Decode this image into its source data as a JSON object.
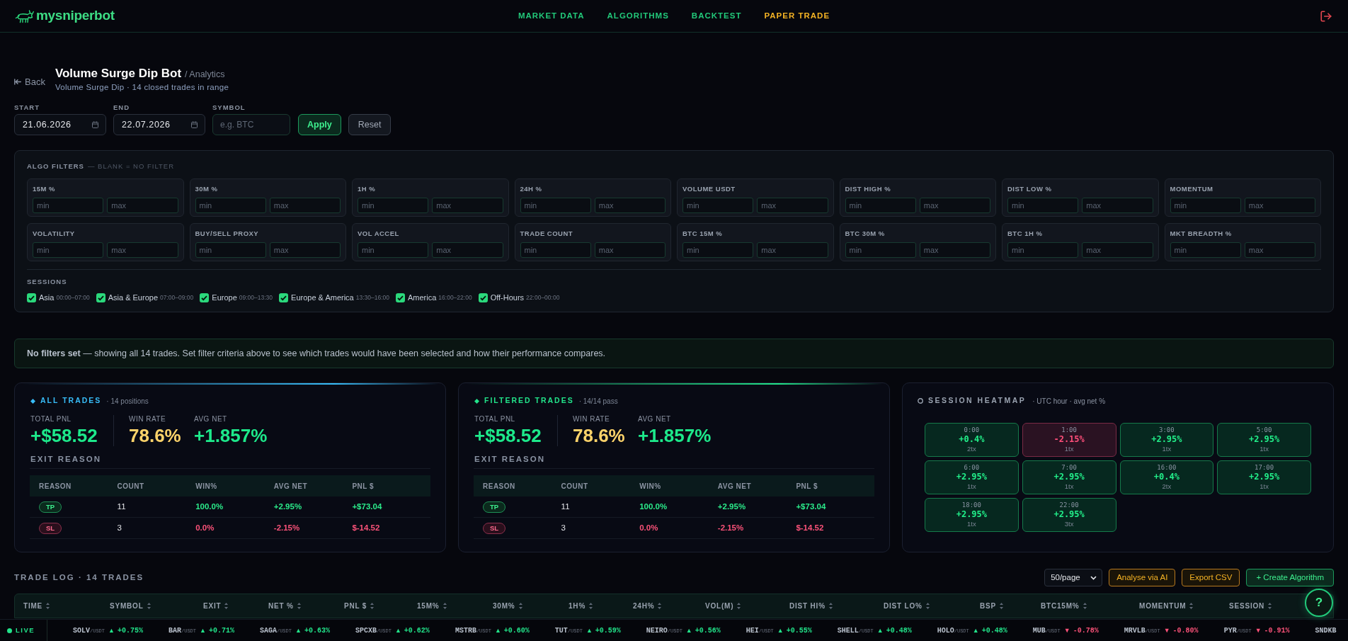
{
  "header": {
    "logo": "mysniperbot",
    "nav": [
      {
        "label": "MARKET DATA",
        "selected": false
      },
      {
        "label": "ALGORITHMS",
        "selected": false
      },
      {
        "label": "BACKTEST",
        "selected": false
      },
      {
        "label": "PAPER TRADE",
        "selected": true
      }
    ]
  },
  "page": {
    "back": "Back",
    "title": "Volume Surge Dip Bot",
    "breadcrumb": "/ Analytics",
    "subtitle": "Volume Surge Dip · 14 closed trades in range"
  },
  "range_filters": {
    "fields": [
      {
        "label": "START",
        "kind": "date",
        "value": "21.06.2026"
      },
      {
        "label": "END",
        "kind": "date",
        "value": "22.07.2026"
      },
      {
        "label": "SYMBOL",
        "kind": "text",
        "placeholder": "e.g. BTC"
      }
    ],
    "buttons": [
      {
        "label": "Apply",
        "kind": "primary"
      },
      {
        "label": "Reset",
        "kind": "secondary"
      }
    ]
  },
  "algo_filters": {
    "title": "ALGO FILTERS",
    "note": "— BLANK = NO FILTER",
    "groups": [
      {
        "label": "15M %",
        "inputs": [
          {
            "placeholder": "min"
          },
          {
            "placeholder": "max"
          }
        ]
      },
      {
        "label": "30M %",
        "inputs": [
          {
            "placeholder": "min"
          },
          {
            "placeholder": "max"
          }
        ]
      },
      {
        "label": "1H %",
        "inputs": [
          {
            "placeholder": "min"
          },
          {
            "placeholder": "max"
          }
        ]
      },
      {
        "label": "24H %",
        "inputs": [
          {
            "placeholder": "min"
          },
          {
            "placeholder": "max"
          }
        ]
      },
      {
        "label": "VOLUME USDT",
        "inputs": [
          {
            "placeholder": "min"
          },
          {
            "placeholder": "max"
          }
        ]
      },
      {
        "label": "DIST HIGH %",
        "inputs": [
          {
            "placeholder": "min"
          },
          {
            "placeholder": "max"
          }
        ]
      },
      {
        "label": "DIST LOW %",
        "inputs": [
          {
            "placeholder": "min"
          },
          {
            "placeholder": "max"
          }
        ]
      },
      {
        "label": "MOMENTUM",
        "inputs": [
          {
            "placeholder": "min"
          },
          {
            "placeholder": "max"
          }
        ]
      },
      {
        "label": "VOLATILITY",
        "inputs": [
          {
            "placeholder": "min"
          },
          {
            "placeholder": "max"
          }
        ]
      },
      {
        "label": "BUY/SELL PROXY",
        "inputs": [
          {
            "placeholder": "min"
          },
          {
            "placeholder": "max"
          }
        ]
      },
      {
        "label": "VOL ACCEL",
        "inputs": [
          {
            "placeholder": "min"
          },
          {
            "placeholder": "max"
          }
        ]
      },
      {
        "label": "TRADE COUNT",
        "inputs": [
          {
            "placeholder": "min"
          },
          {
            "placeholder": "max"
          }
        ]
      },
      {
        "label": "BTC 15M %",
        "inputs": [
          {
            "placeholder": "min"
          },
          {
            "placeholder": "max"
          }
        ]
      },
      {
        "label": "BTC 30M %",
        "inputs": [
          {
            "placeholder": "min"
          },
          {
            "placeholder": "max"
          }
        ]
      },
      {
        "label": "BTC 1H %",
        "inputs": [
          {
            "placeholder": "min"
          },
          {
            "placeholder": "max"
          }
        ]
      },
      {
        "label": "MKT BREADTH %",
        "inputs": [
          {
            "placeholder": "min"
          },
          {
            "placeholder": "max"
          }
        ]
      }
    ],
    "sessions": {
      "label": "SESSIONS",
      "items": [
        {
          "name": "Asia",
          "hours": "00:00–07:00",
          "checked": true
        },
        {
          "name": "Asia & Europe",
          "hours": "07:00–09:00",
          "checked": true
        },
        {
          "name": "Europe",
          "hours": "09:00–13:30",
          "checked": true
        },
        {
          "name": "Europe & America",
          "hours": "13:30–16:00",
          "checked": true
        },
        {
          "name": "America",
          "hours": "16:00–22:00",
          "checked": true
        },
        {
          "name": "Off-Hours",
          "hours": "22:00–00:00",
          "checked": true
        }
      ]
    }
  },
  "notice": "**No filters set** — showing all 14 trades. Set filter criteria above to see which trades would have been selected and how their performance compares.",
  "summary_cards": [
    {
      "title": "ALL TRADES",
      "meta": "· 14 positions",
      "color": "#38bdf8",
      "stats": [
        {
          "label": "TOTAL PNL",
          "value": "+$58.52",
          "kind": "pnl"
        },
        {
          "label": "WIN RATE",
          "value": "78.6%",
          "kind": "rate"
        },
        {
          "label": "AVG NET",
          "value": "+1.857%",
          "kind": "net"
        }
      ],
      "exit_reason": {
        "title": "EXIT REASON",
        "columns": [
          "REASON",
          "COUNT",
          "WIN%",
          "AVG NET",
          "PNL $"
        ],
        "rows": [
          {
            "reason": "TP",
            "negative": false,
            "count": "11",
            "win": "100.0%",
            "avg_net": "+2.95%",
            "pnl": "+$73.04"
          },
          {
            "reason": "SL",
            "negative": true,
            "count": "3",
            "win": "0.0%",
            "avg_net": "-2.15%",
            "pnl": "$-14.52"
          }
        ]
      }
    },
    {
      "title": "FILTERED TRADES",
      "meta": "· 14/14 pass",
      "color": "#22e38a",
      "stats": [
        {
          "label": "TOTAL PNL",
          "value": "+$58.52",
          "kind": "pnl"
        },
        {
          "label": "WIN RATE",
          "value": "78.6%",
          "kind": "rate"
        },
        {
          "label": "AVG NET",
          "value": "+1.857%",
          "kind": "net"
        }
      ],
      "exit_reason": {
        "title": "EXIT REASON",
        "columns": [
          "REASON",
          "COUNT",
          "WIN%",
          "AVG NET",
          "PNL $"
        ],
        "rows": [
          {
            "reason": "TP",
            "negative": false,
            "count": "11",
            "win": "100.0%",
            "avg_net": "+2.95%",
            "pnl": "+$73.04"
          },
          {
            "reason": "SL",
            "negative": true,
            "count": "3",
            "win": "0.0%",
            "avg_net": "-2.15%",
            "pnl": "$-14.52"
          }
        ]
      }
    }
  ],
  "heatmap": {
    "title": "SESSION HEATMAP",
    "meta": "· UTC hour · avg net %",
    "cells": [
      {
        "hour": "0:00",
        "value": "+0.4%",
        "count": "2tx",
        "negative": false
      },
      {
        "hour": "1:00",
        "value": "-2.15%",
        "count": "1tx",
        "negative": true
      },
      {
        "hour": "3:00",
        "value": "+2.95%",
        "count": "1tx",
        "negative": false
      },
      {
        "hour": "5:00",
        "value": "+2.95%",
        "count": "1tx",
        "negative": false
      },
      {
        "hour": "6:00",
        "value": "+2.95%",
        "count": "1tx",
        "negative": false
      },
      {
        "hour": "7:00",
        "value": "+2.95%",
        "count": "1tx",
        "negative": false
      },
      {
        "hour": "16:00",
        "value": "+0.4%",
        "count": "2tx",
        "negative": false
      },
      {
        "hour": "17:00",
        "value": "+2.95%",
        "count": "1tx",
        "negative": false
      },
      {
        "hour": "18:00",
        "value": "+2.95%",
        "count": "1tx",
        "negative": false
      },
      {
        "hour": "22:00",
        "value": "+2.95%",
        "count": "3tx",
        "negative": false
      }
    ]
  },
  "trade_log": {
    "title": "TRADE LOG · 14 TRADES",
    "page_size": "50/page",
    "buttons": [
      {
        "label": "Analyse via AI",
        "kind": "ai"
      },
      {
        "label": "Export CSV",
        "kind": "export"
      },
      {
        "label": "+ Create Algorithm",
        "kind": "create"
      }
    ],
    "columns": [
      "TIME",
      "SYMBOL",
      "EXIT",
      "NET %",
      "PNL $",
      "15M%",
      "30M%",
      "1H%",
      "24H%",
      "VOL(M)",
      "DIST HI%",
      "DIST LO%",
      "BSP",
      "BTC15M%",
      "MOMENTUM",
      "SESSION"
    ]
  },
  "help_button": "?",
  "ticker": {
    "label": "LIVE",
    "items": [
      {
        "symbol": "SOLV",
        "quote": "/USDT",
        "arrow": "▲",
        "change": "+0.75%",
        "negative": false
      },
      {
        "symbol": "BAR",
        "quote": "/USDT",
        "arrow": "▲",
        "change": "+0.71%",
        "negative": false
      },
      {
        "symbol": "SAGA",
        "quote": "/USDT",
        "arrow": "▲",
        "change": "+0.63%",
        "negative": false
      },
      {
        "symbol": "SPCXB",
        "quote": "/USDT",
        "arrow": "▲",
        "change": "+0.62%",
        "negative": false
      },
      {
        "symbol": "MSTRB",
        "quote": "/USDT",
        "arrow": "▲",
        "change": "+0.60%",
        "negative": false
      },
      {
        "symbol": "TUT",
        "quote": "/USDT",
        "arrow": "▲",
        "change": "+0.59%",
        "negative": false
      },
      {
        "symbol": "NEIRO",
        "quote": "/USDT",
        "arrow": "▲",
        "change": "+0.56%",
        "negative": false
      },
      {
        "symbol": "HEI",
        "quote": "/USDT",
        "arrow": "▲",
        "change": "+0.55%",
        "negative": false
      },
      {
        "symbol": "SHELL",
        "quote": "/USDT",
        "arrow": "▲",
        "change": "+0.48%",
        "negative": false
      },
      {
        "symbol": "HOLO",
        "quote": "/USDT",
        "arrow": "▲",
        "change": "+0.48%",
        "negative": false
      },
      {
        "symbol": "MUB",
        "quote": "/USDT",
        "arrow": "▼",
        "change": "-0.78%",
        "negative": true
      },
      {
        "symbol": "MRVLB",
        "quote": "/USDT",
        "arrow": "▼",
        "change": "-0.80%",
        "negative": true
      },
      {
        "symbol": "PYR",
        "quote": "/USDT",
        "arrow": "▼",
        "change": "-0.91%",
        "negative": true
      },
      {
        "symbol": "SNDKB"
      }
    ]
  }
}
